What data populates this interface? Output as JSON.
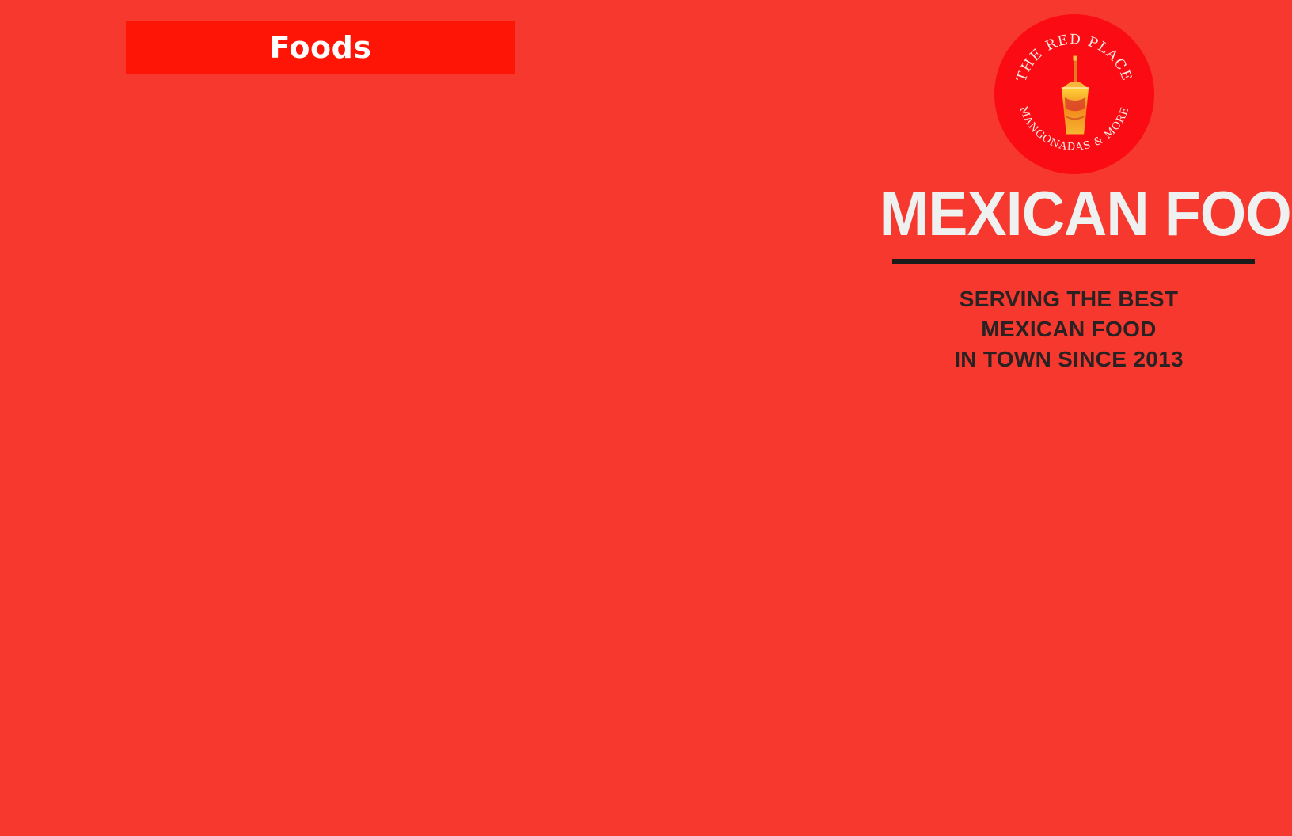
{
  "nav": {
    "foods_label": "Foods"
  },
  "logo": {
    "top_text": "THE RED PLACE",
    "bottom_text": "MANGONADAS & MORE",
    "icon": "mangonada-cup-icon"
  },
  "hero": {
    "title": "MEXICAN FOOD",
    "tagline_lines": [
      "SERVING THE BEST",
      "MEXICAN FOOD",
      "IN TOWN SINCE 2013"
    ]
  },
  "colors": {
    "background": "#f6382e",
    "banner": "#ff1505",
    "logo_circle": "#fb0c14",
    "title_text": "#eef1ef",
    "tagline_text": "#2a2222",
    "divider": "#1b1b1b"
  }
}
